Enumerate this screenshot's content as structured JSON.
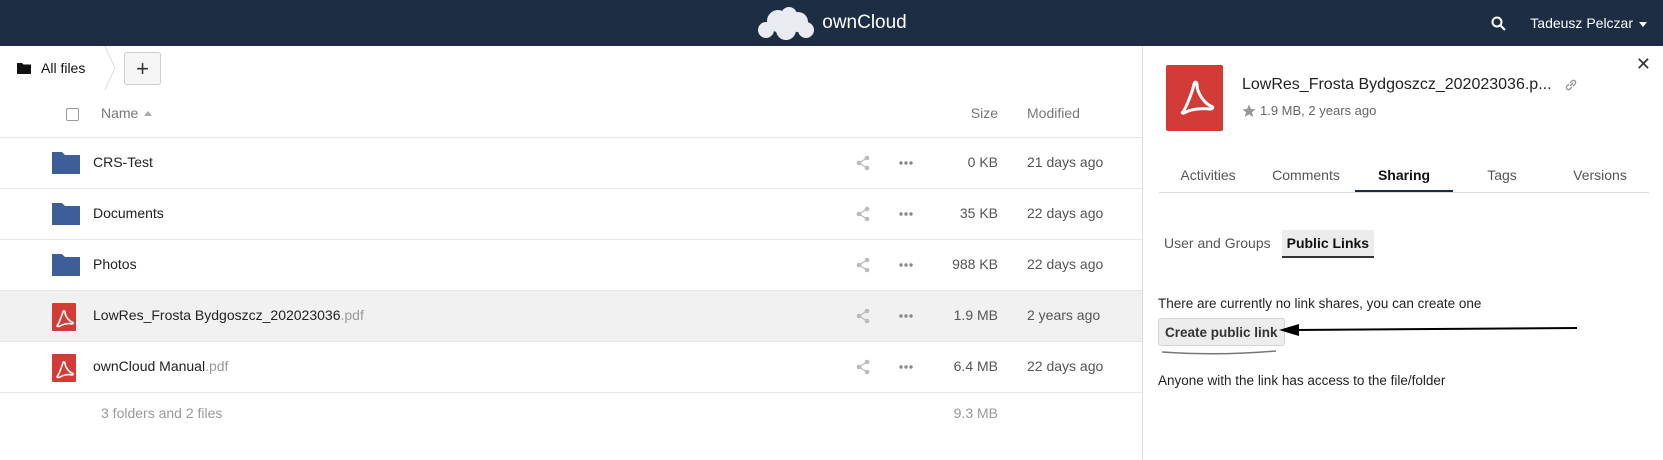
{
  "header": {
    "brand": "ownCloud",
    "user": "Tadeusz Pelczar"
  },
  "breadcrumb": {
    "home_label": "All files",
    "new_label": "+"
  },
  "table": {
    "col_name": "Name",
    "col_size": "Size",
    "col_modified": "Modified"
  },
  "files": [
    {
      "name": "CRS-Test",
      "ext": "",
      "type": "folder",
      "size": "0 KB",
      "modified": "21 days ago"
    },
    {
      "name": "Documents",
      "ext": "",
      "type": "folder",
      "size": "35 KB",
      "modified": "22 days ago"
    },
    {
      "name": "Photos",
      "ext": "",
      "type": "folder",
      "size": "988 KB",
      "modified": "22 days ago"
    },
    {
      "name": "LowRes_Frosta Bydgoszcz_202023036",
      "ext": ".pdf",
      "type": "pdf",
      "size": "1.9 MB",
      "modified": "2 years ago"
    },
    {
      "name": "ownCloud Manual",
      "ext": ".pdf",
      "type": "pdf",
      "size": "6.4 MB",
      "modified": "22 days ago"
    }
  ],
  "summary": {
    "text": "3 folders and 2 files",
    "size": "9.3 MB"
  },
  "details": {
    "title": "LowRes_Frosta Bydgoszcz_202023036.p...",
    "meta": "1.9 MB, 2 years ago",
    "tabs": [
      "Activities",
      "Comments",
      "Sharing",
      "Tags",
      "Versions"
    ],
    "subtabs": [
      "User and Groups",
      "Public Links"
    ],
    "no_links_text": "There are currently no link shares, you can create one",
    "create_button": "Create public link",
    "access_text": "Anyone with the link has access to the file/folder"
  },
  "colors": {
    "topbar": "#1d2d44",
    "folder": "#3e5e97",
    "pdf": "#d23b36"
  }
}
